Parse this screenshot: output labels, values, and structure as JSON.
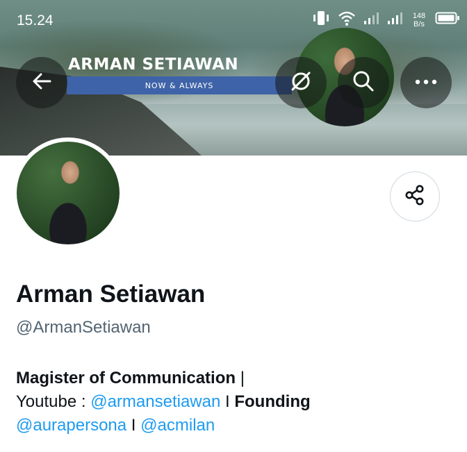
{
  "status_bar": {
    "time": "15.24",
    "net_speed_value": "148",
    "net_speed_unit": "B/s"
  },
  "banner": {
    "title": "ARMAN SETIAWAN",
    "tagline": "NOW & ALWAYS"
  },
  "header_actions": {
    "back_icon": "arrow-left-icon",
    "data_saver_icon": "slash-circle-icon",
    "search_icon": "search-icon",
    "more_icon": "more-horizontal-icon"
  },
  "share": {
    "icon": "share-icon"
  },
  "profile": {
    "display_name": "Arman Setiawan",
    "handle": "@ArmanSetiawan"
  },
  "bio": {
    "line1_bold": "Magister of Communication",
    "line1_sep": " |",
    "line2_prefix": "Youtube : ",
    "line2_mention": "@armansetiawan",
    "line2_sep": " I ",
    "line2_bold": "Founding",
    "line3_mention1": "@aurapersona",
    "line3_sep": " I ",
    "line3_mention2": "@acmilan"
  },
  "colors": {
    "mention": "#1d9bf0",
    "secondary_text": "#536471",
    "banner_strip": "#3f63a8"
  }
}
